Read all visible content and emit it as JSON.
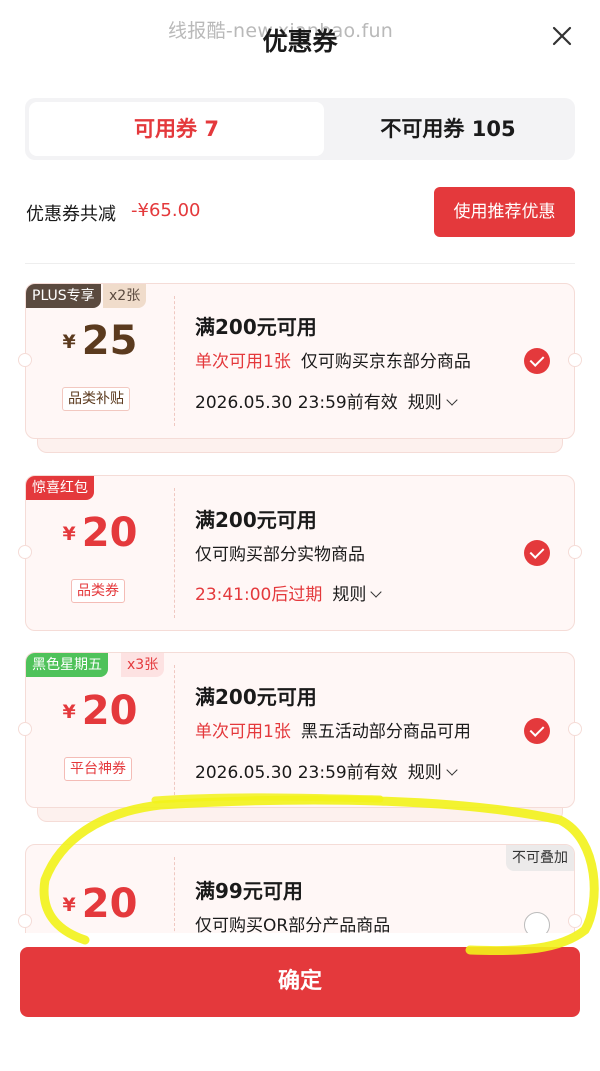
{
  "header": {
    "watermark": "线报酷-new.xianbao.fun",
    "title": "优惠券",
    "close_icon": "close-icon"
  },
  "tabs": [
    {
      "label": "可用券 7",
      "active": true
    },
    {
      "label": "不可用券 105",
      "active": false
    }
  ],
  "summary": {
    "label": "优惠券共减",
    "amount": "-¥65.00",
    "recommend_button": "使用推荐优惠"
  },
  "coupons": [
    {
      "tag": "PLUS专享",
      "tag_count": "x2张",
      "currency": "¥",
      "amount": "25",
      "category": "品类补贴",
      "title": "满200元可用",
      "limit": "单次可用1张",
      "scope": "仅可购买京东部分商品",
      "validity": "2026.05.30 23:59前有效",
      "rule_label": "规则",
      "selected": true
    },
    {
      "tag": "惊喜红包",
      "currency": "¥",
      "amount": "20",
      "category": "品类券",
      "title": "满200元可用",
      "scope": "仅可购买部分实物商品",
      "validity": "23:41:00后过期",
      "rule_label": "规则",
      "selected": true
    },
    {
      "tag": "黑色星期五",
      "tag_count": "x3张",
      "currency": "¥",
      "amount": "20",
      "category": "平台神券",
      "title": "满200元可用",
      "limit": "单次可用1张",
      "scope": "黑五活动部分商品可用",
      "validity": "2026.05.30 23:59前有效",
      "rule_label": "规则",
      "selected": true
    },
    {
      "corner_tag": "不可叠加",
      "currency": "¥",
      "amount": "20",
      "title": "满99元可用",
      "scope": "仅可购买OR部分产品商品",
      "selected": false
    }
  ],
  "confirm_button": "确定",
  "colors": {
    "accent": "#e4393c",
    "highlight": "#f2f21a",
    "plus_brown": "#5b4a3f",
    "green_tag": "#4fc25a"
  }
}
